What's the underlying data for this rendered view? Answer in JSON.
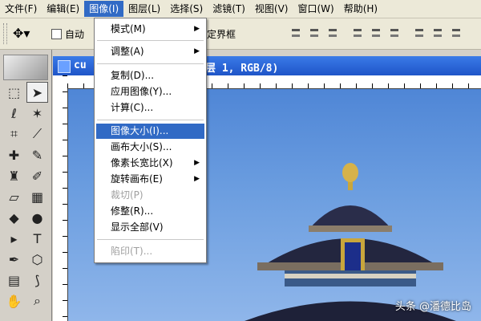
{
  "menubar": {
    "items": [
      "文件(F)",
      "编辑(E)",
      "图像(I)",
      "图层(L)",
      "选择(S)",
      "滤镜(T)",
      "视图(V)",
      "窗口(W)",
      "帮助(H)"
    ]
  },
  "options": {
    "auto_select_label": "自动",
    "bounding_label": "定界框"
  },
  "document": {
    "title_left": "cu",
    "title_right": "层 1, RGB/8)"
  },
  "image_menu": {
    "mode": "模式(M)",
    "adjust": "调整(A)",
    "duplicate": "复制(D)...",
    "apply_image": "应用图像(Y)...",
    "calculations": "计算(C)...",
    "image_size": "图像大小(I)...",
    "canvas_size": "画布大小(S)...",
    "pixel_aspect": "像素长宽比(X)",
    "rotate_canvas": "旋转画布(E)",
    "crop": "裁切(P)",
    "trim": "修整(R)...",
    "reveal_all": "显示全部(V)",
    "trap": "陷印(T)..."
  },
  "watermark": "头条 @潘德比岛",
  "colors": {
    "menu_highlight": "#316ac5",
    "title_bar": "#1f55c8",
    "sky": "#6c9ee0"
  }
}
